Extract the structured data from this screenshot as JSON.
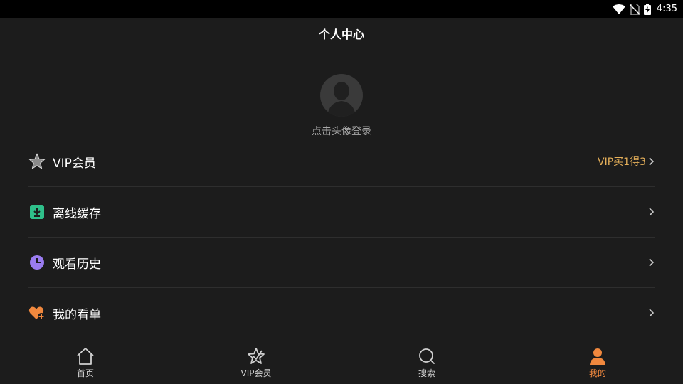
{
  "status": {
    "time": "4:35"
  },
  "header": {
    "title": "个人中心"
  },
  "profile": {
    "login_hint": "点击头像登录"
  },
  "menu": [
    {
      "label": "VIP会员",
      "icon": "star-icon",
      "promo": "VIP买1得3"
    },
    {
      "label": "离线缓存",
      "icon": "download-icon",
      "promo": ""
    },
    {
      "label": "观看历史",
      "icon": "clock-icon",
      "promo": ""
    },
    {
      "label": "我的看单",
      "icon": "heart-plus-icon",
      "promo": ""
    }
  ],
  "tabs": [
    {
      "label": "首页",
      "icon": "home-icon"
    },
    {
      "label": "VIP会员",
      "icon": "vip-star-icon"
    },
    {
      "label": "搜索",
      "icon": "search-icon"
    },
    {
      "label": "我的",
      "icon": "user-icon",
      "active": true
    }
  ],
  "colors": {
    "background": "#1c1c1c",
    "accent": "#f0883e",
    "promo": "#e6b05a",
    "download_icon": "#2fbf8a",
    "clock_icon": "#9a7cf0",
    "heart_icon": "#f0883e"
  }
}
